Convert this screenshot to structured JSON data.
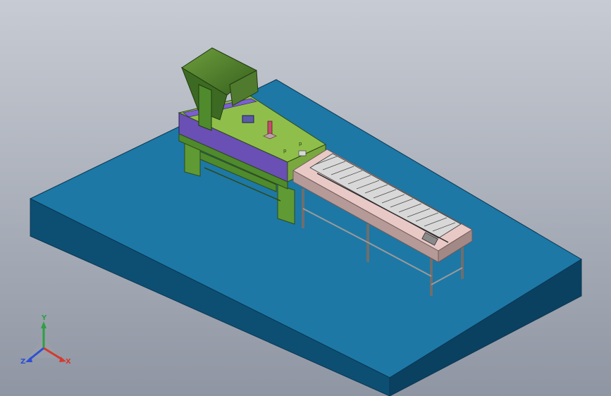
{
  "viewport": {
    "background_top": "#c7cbd3",
    "background_bottom": "#8f96a3"
  },
  "colors": {
    "base_top": "#1d78a6",
    "base_front": "#0d4f72",
    "base_side": "#0b4160",
    "machine_green": "#8fbf4a",
    "machine_green_dark": "#4f8a2c",
    "machine_purple": "#6a4fb5",
    "conveyor_pink": "#e9c9c6",
    "conveyor_frame": "#b59a97",
    "steel": "#c9c9c9",
    "steel_dark": "#6e6e6e",
    "hopper": "#4a7a2c",
    "axis_x": "#d43a2f",
    "axis_y": "#2ea043",
    "axis_z": "#2f4fd4"
  },
  "triad": {
    "x_label": "X",
    "y_label": "Y",
    "z_label": "Z"
  }
}
